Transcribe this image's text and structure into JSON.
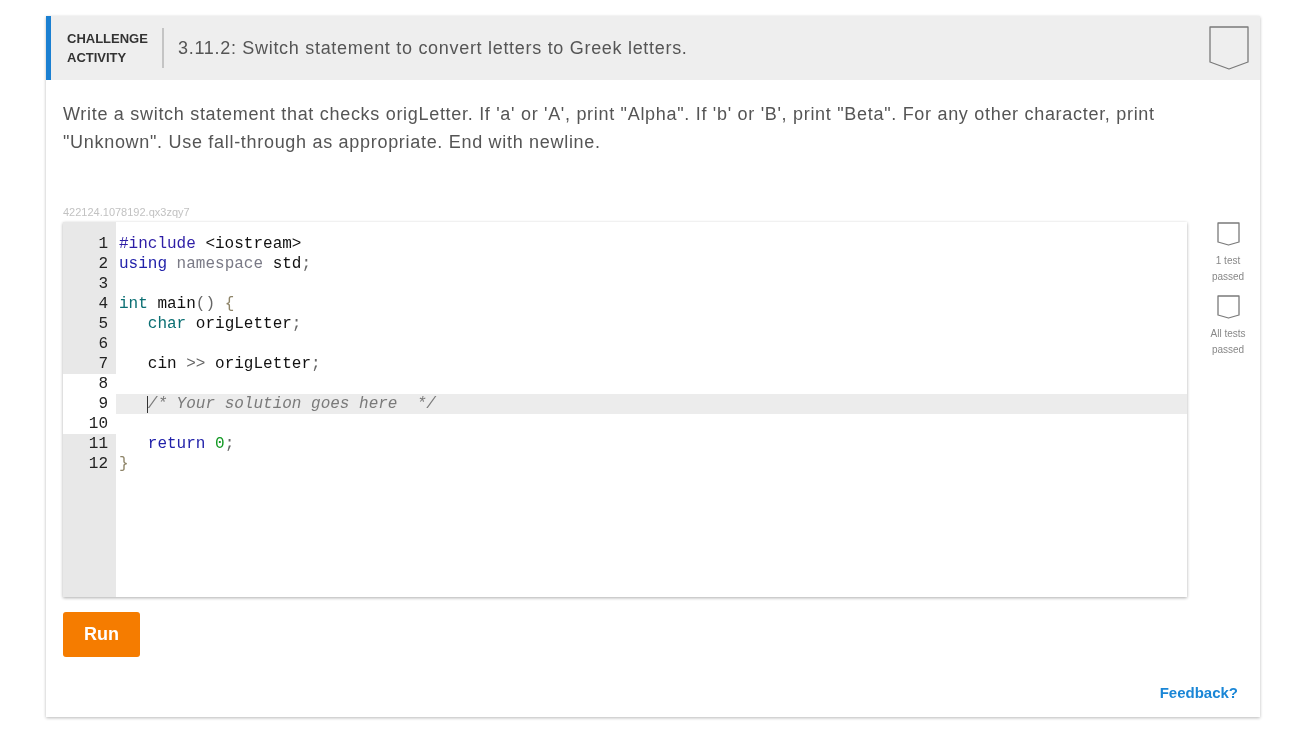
{
  "header": {
    "label": "CHALLENGE ACTIVITY",
    "title": "3.11.2: Switch statement to convert letters to Greek letters.",
    "completed": false
  },
  "instructions": "Write a switch statement that checks origLetter. If 'a' or 'A', print \"Alpha\". If 'b' or 'B', print \"Beta\". For any other character, print \"Unknown\". Use fall-through as appropriate. End with newline.",
  "activity_id": "422124.1078192.qx3zqy7",
  "editor": {
    "lines": [
      {
        "number": "1",
        "editable": false,
        "active": false,
        "tokens": [
          {
            "kind": "meta",
            "text": "#include"
          },
          {
            "kind": "plain",
            "text": " <iostream>"
          }
        ]
      },
      {
        "number": "2",
        "editable": false,
        "active": false,
        "tokens": [
          {
            "kind": "keyword",
            "text": "using"
          },
          {
            "kind": "qualifier",
            "text": " namespace"
          },
          {
            "kind": "plain",
            "text": " std"
          },
          {
            "kind": "punct",
            "text": ";"
          }
        ]
      },
      {
        "number": "3",
        "editable": false,
        "active": false
      },
      {
        "number": "4",
        "editable": false,
        "active": false,
        "tokens": [
          {
            "kind": "type",
            "text": "int"
          },
          {
            "kind": "plain",
            "text": " main"
          },
          {
            "kind": "punct",
            "text": "()"
          },
          {
            "kind": "bracket",
            "text": " {"
          }
        ]
      },
      {
        "number": "5",
        "editable": false,
        "active": false,
        "tokens": [
          {
            "kind": "type",
            "text": "   char"
          },
          {
            "kind": "plain",
            "text": " origLetter"
          },
          {
            "kind": "punct",
            "text": ";"
          }
        ]
      },
      {
        "number": "6",
        "editable": false,
        "active": false
      },
      {
        "number": "7",
        "editable": false,
        "active": false,
        "tokens": [
          {
            "kind": "plain",
            "text": "   cin "
          },
          {
            "kind": "punct",
            "text": ">>"
          },
          {
            "kind": "plain",
            "text": " origLetter"
          },
          {
            "kind": "punct",
            "text": ";"
          }
        ]
      },
      {
        "number": "8",
        "editable": true,
        "active": false
      },
      {
        "number": "9",
        "editable": true,
        "active": true,
        "tokens": [
          {
            "kind": "comment",
            "text": "   /* Your solution goes here  */"
          }
        ]
      },
      {
        "number": "10",
        "editable": true,
        "active": false
      },
      {
        "number": "11",
        "editable": false,
        "active": false,
        "tokens": [
          {
            "kind": "keyword",
            "text": "   return"
          },
          {
            "kind": "number",
            "text": " 0"
          },
          {
            "kind": "punct",
            "text": ";"
          }
        ]
      },
      {
        "number": "12",
        "editable": false,
        "active": false,
        "tokens": [
          {
            "kind": "bracket",
            "text": "}"
          }
        ]
      }
    ]
  },
  "tests": [
    {
      "label": "1 test passed",
      "passed": false
    },
    {
      "label": "All tests passed",
      "passed": false
    }
  ],
  "run_button": "Run",
  "feedback_link": "Feedback?"
}
